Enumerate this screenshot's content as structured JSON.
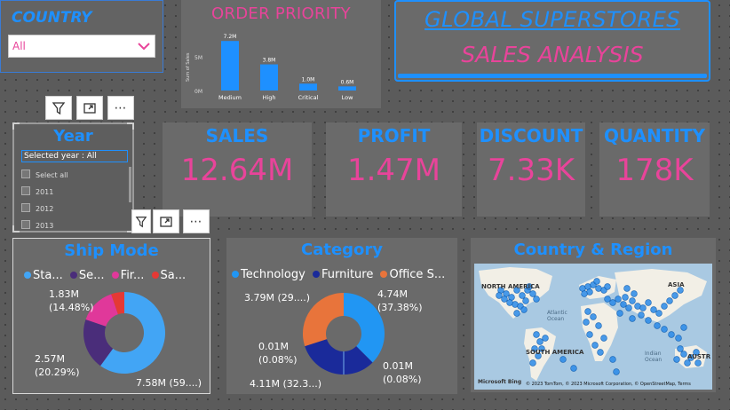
{
  "country_slicer": {
    "title": "COUNTRY",
    "selected": "All"
  },
  "order_priority": {
    "title": "ORDER PRIORITY",
    "y_axis_label": "Sum of Sales",
    "y_ticks": [
      "5M",
      "0M"
    ]
  },
  "title_card": {
    "line1": "GLOBAL SUPERSTORES",
    "line2": "SALES ANALYSIS"
  },
  "year_slicer": {
    "title": "Year",
    "selected_text": "Selected year : All",
    "options": [
      "Select all",
      "2011",
      "2012",
      "2013"
    ]
  },
  "kpis": [
    {
      "label": "SALES",
      "value": "12.64M"
    },
    {
      "label": "PROFIT",
      "value": "1.47M"
    },
    {
      "label": "DISCOUNT",
      "value": "7.33K"
    },
    {
      "label": "QUANTITY",
      "value": "178K"
    }
  ],
  "ship_mode": {
    "title": "Ship Mode",
    "legend": [
      "Sta...",
      "Se...",
      "Fir...",
      "Sa..."
    ],
    "labels": {
      "first": "1.83M",
      "first_pct": "(14.48%)",
      "second": "2.57M",
      "second_pct": "(20.29%)",
      "standard": "7.58M (59....)"
    }
  },
  "category": {
    "title": "Category",
    "legend": [
      "Technology",
      "Furniture",
      "Office S..."
    ],
    "labels": {
      "office": "3.79M (29....)",
      "tech": "4.74M",
      "tech_pct": "(37.38%)",
      "small_left": "0.01M",
      "small_left_pct": "(0.08%)",
      "small_right": "0.01M",
      "small_right_pct": "(0.08%)",
      "furniture": "4.11M (32.3...)"
    }
  },
  "map": {
    "title": "Country & Region",
    "labels": {
      "na": "NORTH AMERICA",
      "sa": "SOUTH AMERICA",
      "asia": "ASIA",
      "atlantic": "Atlantic Ocean",
      "indian": "Indian Ocean",
      "austr": "AUSTR"
    },
    "footer": "© 2023 TomTom, © 2023 Microsoft Corporation, © OpenStreetMap, Terms",
    "bing": "Microsoft Bing"
  },
  "colors": {
    "accent_blue": "#1e90ff",
    "accent_pink": "#e8449a",
    "standard_class": "#42a5f5",
    "second_class": "#4a2d7a",
    "first_class": "#e0389a",
    "same_day": "#e53935",
    "technology": "#2196f3",
    "furniture": "#1a2a9a",
    "office_supplies": "#e8743b"
  },
  "chart_data": [
    {
      "type": "bar",
      "title": "ORDER PRIORITY",
      "ylabel": "Sum of Sales",
      "categories": [
        "Medium",
        "High",
        "Critical",
        "Low"
      ],
      "values": [
        7.2,
        3.8,
        1.0,
        0.6
      ],
      "value_labels": [
        "7.2M",
        "3.8M",
        "1.0M",
        "0.6M"
      ],
      "ylim": [
        0,
        8
      ]
    },
    {
      "type": "pie",
      "title": "Ship Mode",
      "categories": [
        "Standard Class",
        "Second Class",
        "First Class",
        "Same Day"
      ],
      "values": [
        7.58,
        2.57,
        1.83,
        0.66
      ],
      "percents": [
        59.97,
        20.29,
        14.48,
        5.26
      ]
    },
    {
      "type": "pie",
      "title": "Category",
      "categories": [
        "Technology",
        "Furniture",
        "Office Supplies"
      ],
      "values": [
        4.74,
        4.11,
        3.79
      ],
      "percents": [
        37.38,
        32.3,
        29.94
      ]
    }
  ]
}
